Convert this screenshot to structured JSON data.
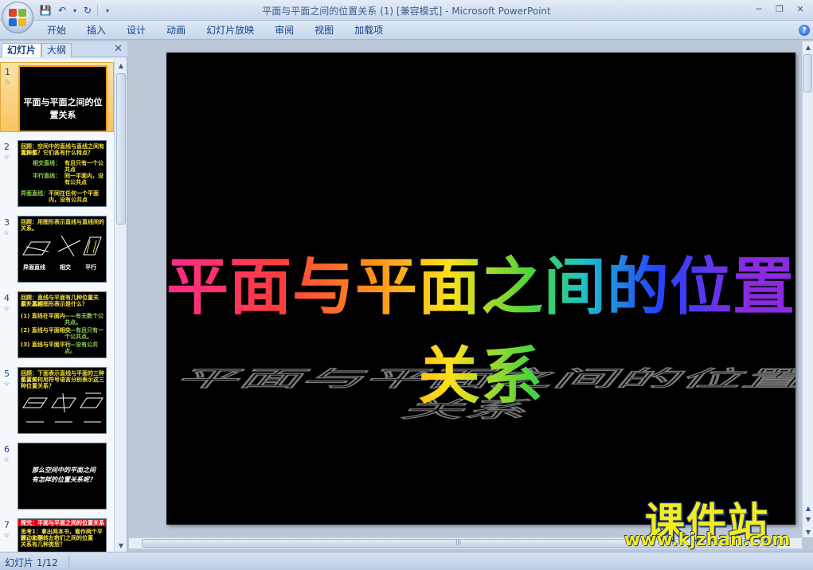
{
  "window": {
    "title": "平面与平面之间的位置关系 (1) [兼容模式]",
    "app_separator": " - ",
    "app_name": "Microsoft PowerPoint"
  },
  "ribbon": {
    "tabs": [
      "开始",
      "插入",
      "设计",
      "动画",
      "幻灯片放映",
      "审阅",
      "视图",
      "加载项"
    ]
  },
  "left_panel": {
    "tabs": [
      "幻灯片",
      "大纲"
    ],
    "active_tab": "幻灯片",
    "slides": [
      {
        "number": "1",
        "title": "平面与平面之间的位置关系"
      },
      {
        "number": "2",
        "lines": [
          "回顾：空间中的直线与直线之间有几种位",
          "置关系？它们各有什么特点？",
          "相交直线：",
          "有且只有一个公共点",
          "平行直线：",
          "同一平面内，没有公共点",
          "异面直线：",
          "不同在任何一个平面内，没有公共点"
        ]
      },
      {
        "number": "3",
        "lines": [
          "回顾：用图形表示直线与直线间的关系。",
          "异面直线",
          "相交",
          "平行"
        ]
      },
      {
        "number": "4",
        "lines": [
          "回顾：直线与平面有几种位置关系？其相",
          "应关系的图形表示是什么？",
          "(1) 直线在平面内",
          "——有无数个公共点。",
          "(2) 直线与平面相交",
          "——有且只有一个公共点。",
          "(3) 直线与平面平行",
          "——没有公共点。"
        ]
      },
      {
        "number": "5",
        "lines": [
          "回顾：下面表示直线与平面的三种位置关",
          "系，如何用符号语言分别表示这三种位置关系？"
        ]
      },
      {
        "number": "6",
        "lines": [
          "那么空间中的平面之间",
          "有怎样的位置关系呢？"
        ]
      },
      {
        "number": "7",
        "lines": [
          "探究：平面与平面之间的位置关系",
          "思考1：拿出两本书，看作两个平面，上下、左右",
          "移动和翻转，它们之间的位置",
          "关系有几种类型？"
        ]
      }
    ]
  },
  "slide": {
    "title": "平面与平面之间的位置关系"
  },
  "status": {
    "slide_indicator": "幻灯片 1/12"
  },
  "watermark": {
    "main": "课件站",
    "url": "www.kjzhan.com"
  },
  "colors": {
    "office_logo": [
      "#e2412b",
      "#7ab640",
      "#1f6fd1",
      "#f3b520"
    ]
  }
}
